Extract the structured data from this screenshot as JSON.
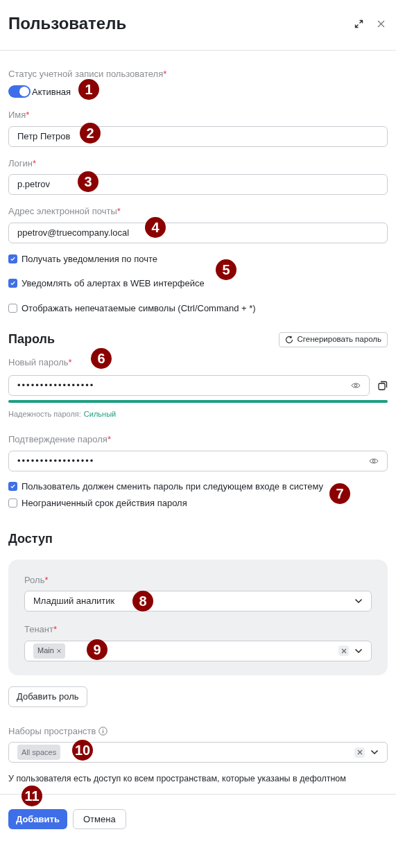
{
  "window": {
    "title": "Пользователь"
  },
  "status": {
    "label": "Статус учетной записи пользователя",
    "required_mark": "*",
    "on": true,
    "value": "Активная"
  },
  "fields": [
    {
      "label": "Имя",
      "required_mark": "*",
      "value": "Петр Петров"
    },
    {
      "label": "Логин",
      "required_mark": "*",
      "value": "p.petrov"
    },
    {
      "label": "Адрес электронной почты",
      "required_mark": "*",
      "value": "ppetrov@truecompany.local"
    }
  ],
  "notification_options": [
    {
      "label": "Получать уведомления по почте",
      "checked": true
    },
    {
      "label": "Уведомлять об алертах в WEB интерфейсе",
      "checked": true
    },
    {
      "label": "Отображать непечатаемые символы (Ctrl/Command + *)",
      "checked": false
    }
  ],
  "password": {
    "heading": "Пароль",
    "generate_button": "Сгенерировать пароль",
    "new_label": "Новый пароль",
    "new_required_mark": "*",
    "new_value": "•••••••••••••••••",
    "strength": {
      "level": 1,
      "label": "Надежность пароля:",
      "value": "Сильный"
    },
    "confirm_label": "Подтверждение пароля",
    "confirm_required_mark": "*",
    "confirm_value": "•••••••••••••••••"
  },
  "password_options": [
    {
      "label": "Пользователь должен сменить пароль при следующем входе в систему",
      "checked": true
    },
    {
      "label": "Неограниченный срок действия пароля",
      "checked": false
    }
  ],
  "access": {
    "heading": "Доступ",
    "role_label": "Роль",
    "role_required_mark": "*",
    "role_value": "Младший аналитик",
    "tenant_label": "Тенант",
    "tenant_required_mark": "*",
    "tenant_tags": [
      "Main"
    ],
    "add_role_button": "Добавить роль"
  },
  "space_sets": {
    "label": "Наборы пространств",
    "tags": [
      "All spaces"
    ],
    "note": "У пользователя есть доступ ко всем пространствам, которые указаны в дефолтном"
  },
  "footer": {
    "primary": "Добавить",
    "secondary": "Отмена"
  },
  "callouts": [
    "1",
    "2",
    "3",
    "4",
    "5",
    "6",
    "7",
    "8",
    "9",
    "10",
    "11"
  ]
}
